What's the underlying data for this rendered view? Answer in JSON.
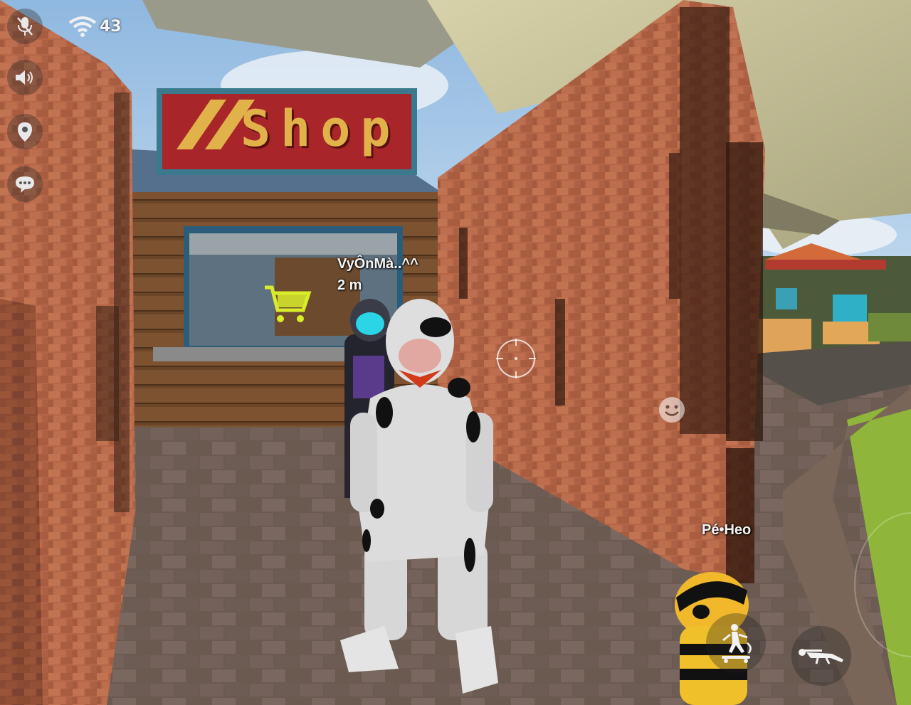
{
  "hud": {
    "mic_icon": "mic-muted-icon",
    "speaker_icon": "speaker-icon",
    "location_icon": "location-pin-icon",
    "chat_icon": "chat-bubble-icon",
    "wifi_icon": "wifi-icon",
    "ping": "43"
  },
  "scene": {
    "shop_sign": "Shop",
    "cart_icon": "shopping-cart-icon"
  },
  "players": {
    "nearby": {
      "name": "VyÔnMà..^^",
      "distance": "2 m"
    },
    "teammate": {
      "name": "Pé•Heo"
    }
  },
  "controls": {
    "crosshair_icon": "crosshair-icon",
    "emote_icon": "smiley-icon",
    "skate_icon": "skateboard-icon",
    "prone_icon": "prone-icon"
  },
  "colors": {
    "sky": "#9fc4e6",
    "brick": "#b8694a",
    "shop_sign_bg": "#a8262a",
    "shop_sign_text": "#e2b24a",
    "cart": "#d8ec2a",
    "grass": "#8fb63a"
  }
}
